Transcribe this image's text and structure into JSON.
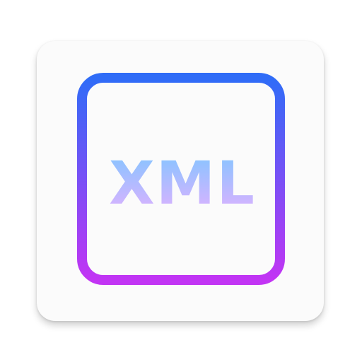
{
  "app_icon": {
    "label": "XML",
    "colors": {
      "tile_background": "#fbfbfb",
      "frame_gradient_top": "#2f6cf7",
      "frame_gradient_bottom": "#c234f4",
      "text_gradient_top": "#7fc6ff",
      "text_gradient_bottom": "#e3b0ff"
    }
  }
}
